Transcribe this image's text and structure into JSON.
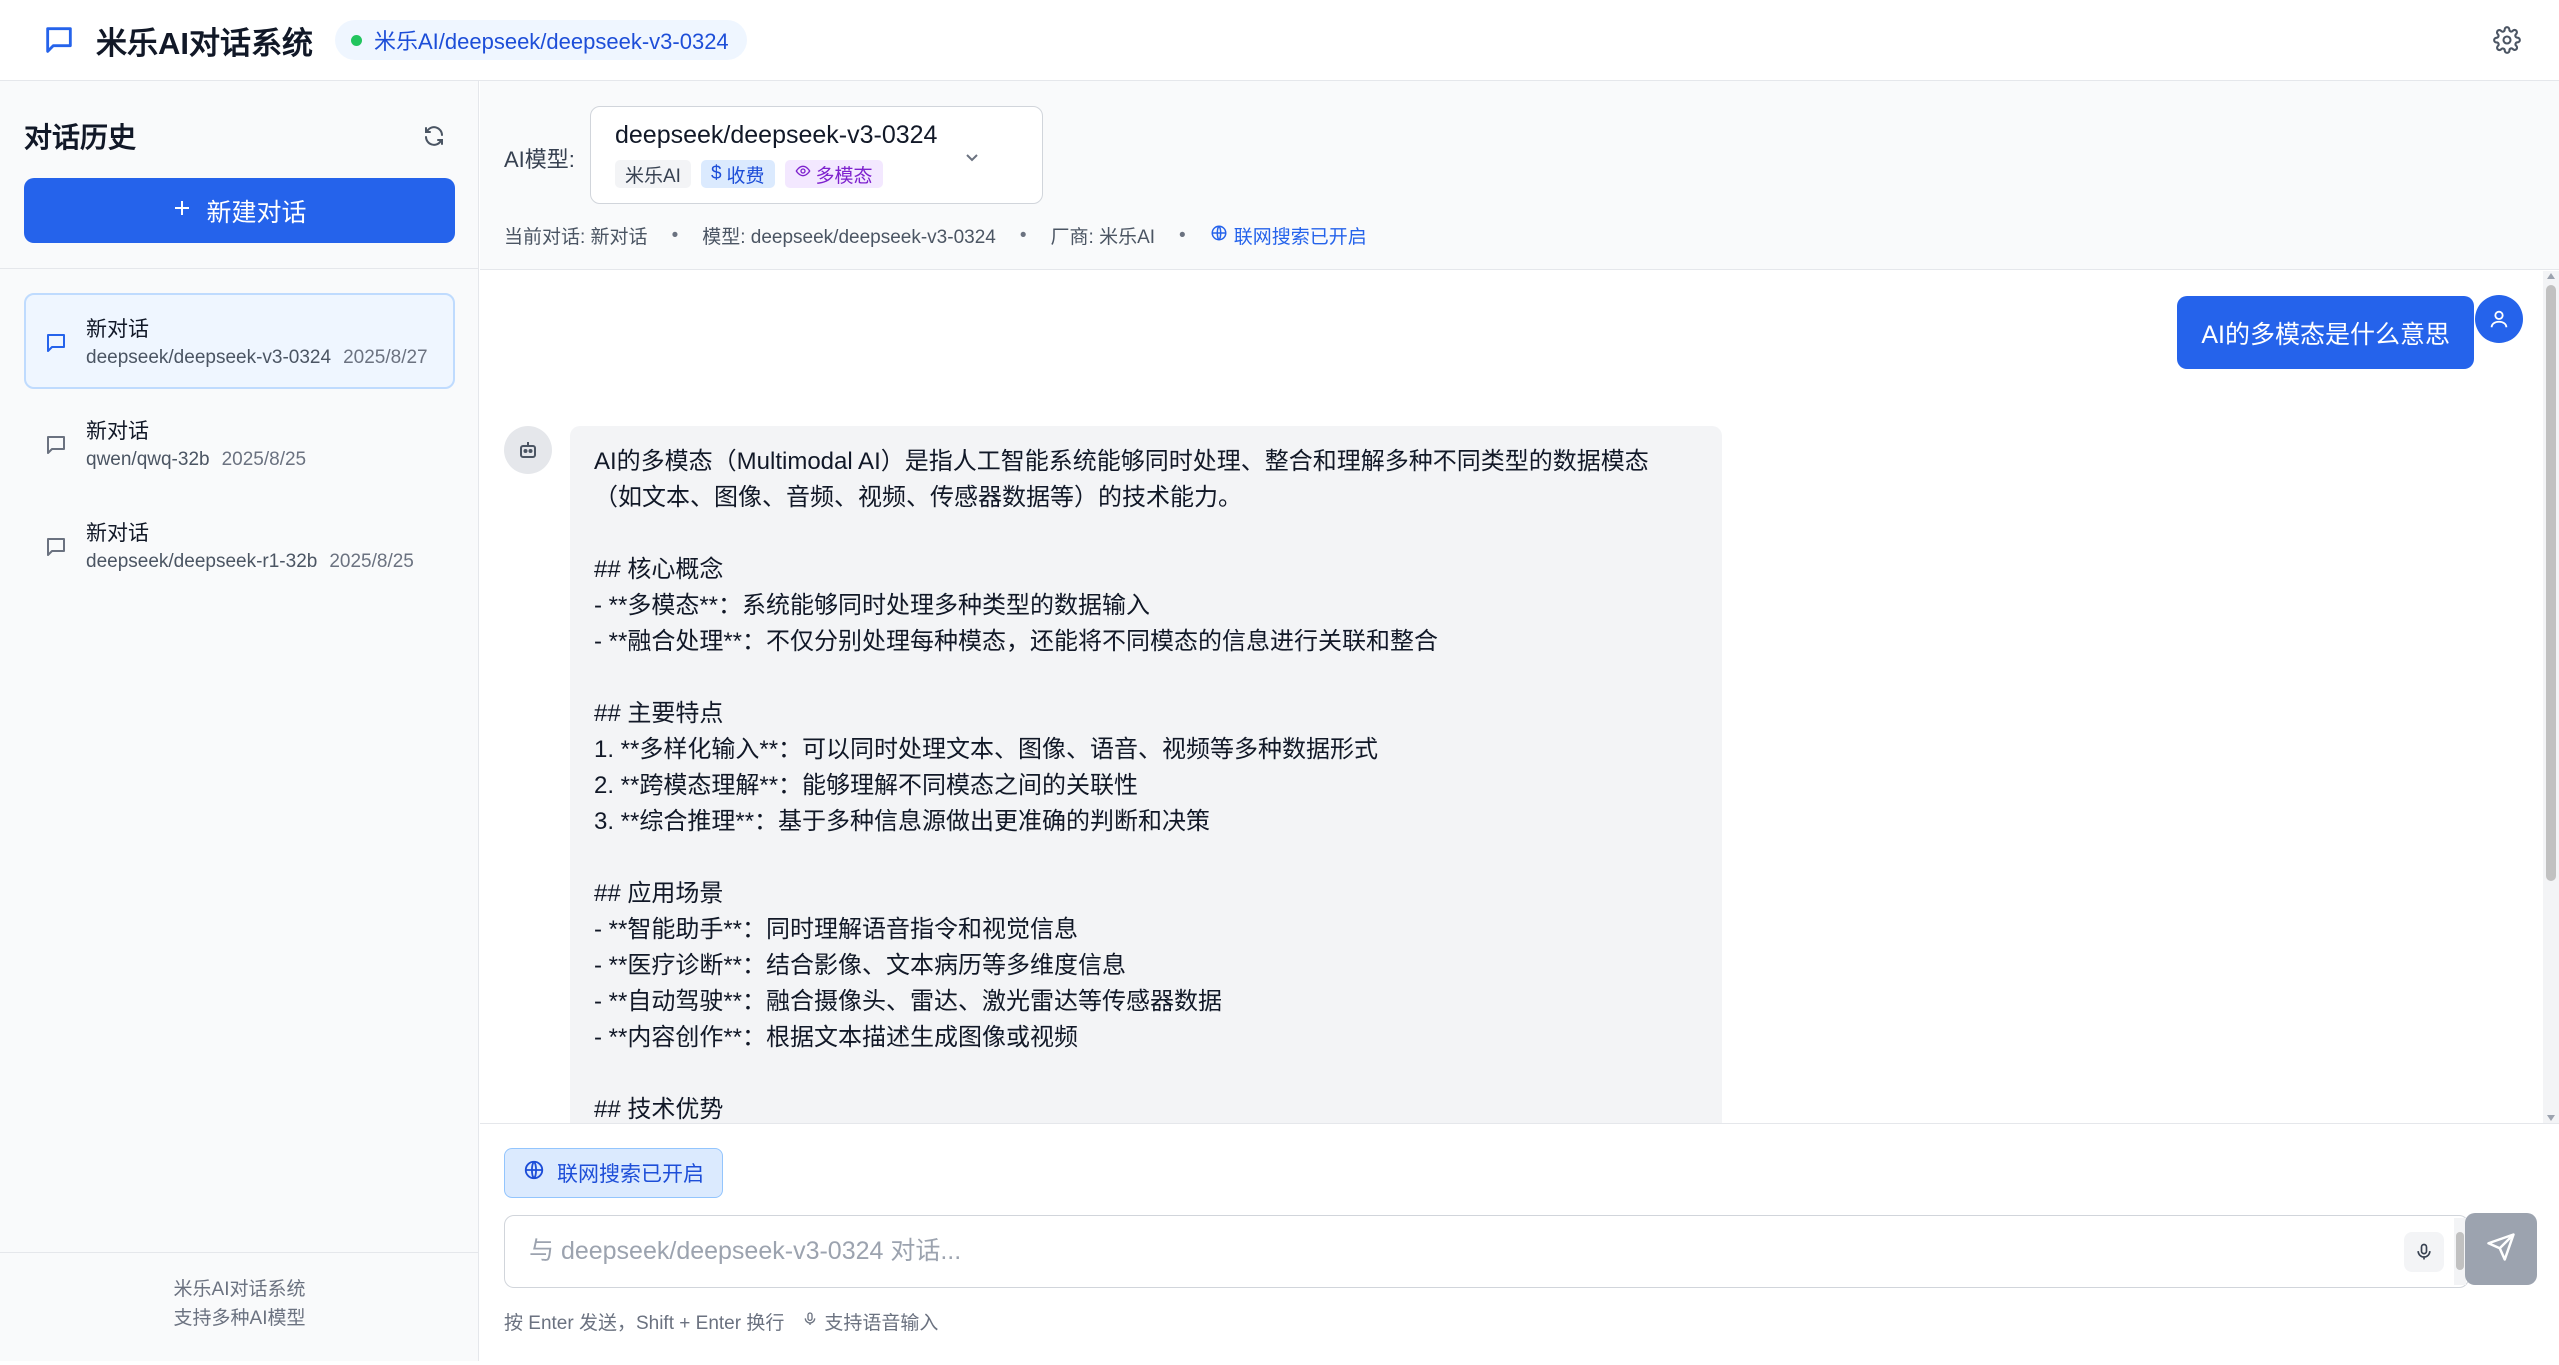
{
  "header": {
    "app_title": "米乐AI对话系统",
    "current_model_pill": "米乐AI/deepseek/deepseek-v3-0324",
    "status_color": "#22c55e",
    "logo_icon": "chat-bubble-icon",
    "settings_icon": "gear-icon"
  },
  "sidebar": {
    "title": "对话历史",
    "refresh_icon": "refresh-icon",
    "new_chat_label": "新建对话",
    "conversations": [
      {
        "title": "新对话",
        "model": "deepseek/deepseek-v3-0324",
        "date": "2025/8/27",
        "active": true
      },
      {
        "title": "新对话",
        "model": "qwen/qwq-32b",
        "date": "2025/8/25",
        "active": false
      },
      {
        "title": "新对话",
        "model": "deepseek/deepseek-r1-32b",
        "date": "2025/8/25",
        "active": false
      }
    ],
    "footer_line1": "米乐AI对话系统",
    "footer_line2": "支持多种AI模型"
  },
  "model_bar": {
    "label": "AI模型:",
    "selected_model": "deepseek/deepseek-v3-0324",
    "tags": {
      "vendor": "米乐AI",
      "paid": "收费",
      "multimodal": "多模态"
    },
    "info": {
      "current_chat": "当前对话: 新对话",
      "model": "模型: deepseek/deepseek-v3-0324",
      "vendor": "厂商: 米乐AI",
      "search": "联网搜索已开启"
    }
  },
  "chat": {
    "user_message": "AI的多模态是什么意思",
    "assistant_lines": [
      "AI的多模态（Multimodal AI）是指人工智能系统能够同时处理、整合和理解多种不同类型的数据模态",
      "（如文本、图像、音频、视频、传感器数据等）的技术能力。",
      "",
      "## 核心概念",
      "- **多模态**：系统能够同时处理多种类型的数据输入",
      "- **融合处理**：不仅分别处理每种模态，还能将不同模态的信息进行关联和整合",
      "",
      "## 主要特点",
      "1. **多样化输入**：可以同时处理文本、图像、语音、视频等多种数据形式",
      "2. **跨模态理解**：能够理解不同模态之间的关联性",
      "3. **综合推理**：基于多种信息源做出更准确的判断和决策",
      "",
      "## 应用场景",
      "- **智能助手**：同时理解语音指令和视觉信息",
      "- **医疗诊断**：结合影像、文本病历等多维度信息",
      "- **自动驾驶**：融合摄像头、雷达、激光雷达等传感器数据",
      "- **内容创作**：根据文本描述生成图像或视频",
      "",
      "## 技术优势"
    ]
  },
  "composer": {
    "search_toggle_label": "联网搜索已开启",
    "placeholder": "与 deepseek/deepseek-v3-0324 对话...",
    "value": "",
    "hint": "按 Enter 发送，Shift + Enter 换行",
    "voice_hint": "支持语音输入"
  }
}
